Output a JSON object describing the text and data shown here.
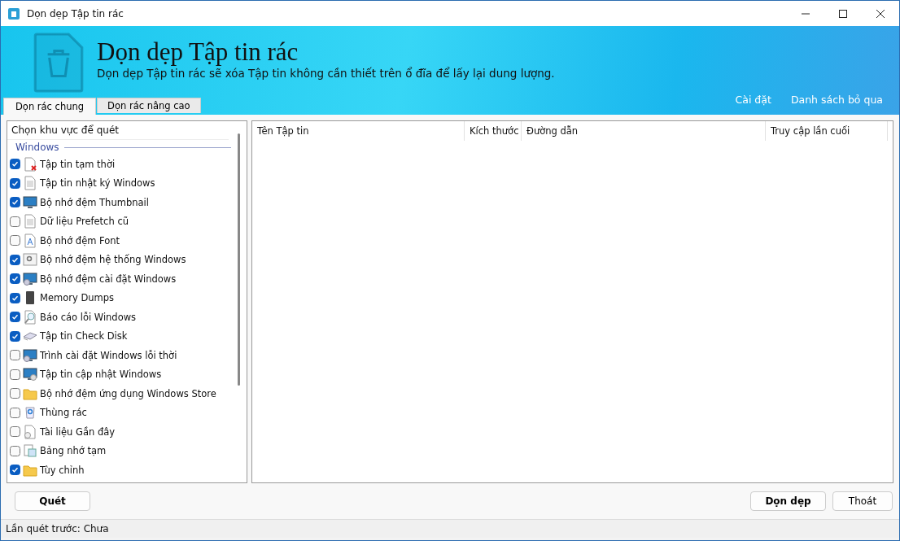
{
  "window": {
    "title": "Dọn dẹp Tập tin rác"
  },
  "header": {
    "title": "Dọn dẹp Tập tin rác",
    "subtitle": "Dọn dẹp Tập tin rác sẽ xóa Tập tin không cần thiết trên ổ đĩa để lấy lại dung lượng.",
    "links": [
      "Cài đặt",
      "Danh sách bỏ qua"
    ]
  },
  "tabs": [
    {
      "label": "Dọn rác chung",
      "selected": true
    },
    {
      "label": "Dọn rác nâng cao",
      "selected": false
    }
  ],
  "area_list": {
    "heading": "Chọn khu vực để quét",
    "group": "Windows",
    "items": [
      {
        "label": "Tập tin tạm thời",
        "checked": true
      },
      {
        "label": "Tập tin nhật ký Windows",
        "checked": true
      },
      {
        "label": "Bộ nhớ đệm Thumbnail",
        "checked": true
      },
      {
        "label": "Dữ liệu Prefetch cũ",
        "checked": false
      },
      {
        "label": "Bộ nhớ đệm Font",
        "checked": false
      },
      {
        "label": "Bộ nhớ đệm hệ thống Windows",
        "checked": true
      },
      {
        "label": "Bộ nhớ đệm cài đặt Windows",
        "checked": true
      },
      {
        "label": "Memory Dumps",
        "checked": true
      },
      {
        "label": "Báo cáo lỗi Windows",
        "checked": true
      },
      {
        "label": "Tập tin Check Disk",
        "checked": true
      },
      {
        "label": "Trình cài đặt Windows lỗi thời",
        "checked": false
      },
      {
        "label": "Tập tin cập nhật Windows",
        "checked": false
      },
      {
        "label": "Bộ nhớ đệm ứng dụng Windows Store",
        "checked": false
      },
      {
        "label": "Thùng rác",
        "checked": false
      },
      {
        "label": "Tài liệu Gần đây",
        "checked": false
      },
      {
        "label": "Bảng nhớ tạm",
        "checked": false
      },
      {
        "label": "Tùy chỉnh",
        "checked": true
      }
    ]
  },
  "table": {
    "columns": [
      "Tên Tập tin",
      "Kích thước",
      "Đường dẫn",
      "Truy cập lần cuối"
    ]
  },
  "buttons": {
    "scan": "Quét",
    "clean": "Dọn dẹp",
    "exit": "Thoát"
  },
  "status_bar": "Lần quét trước: Chưa"
}
